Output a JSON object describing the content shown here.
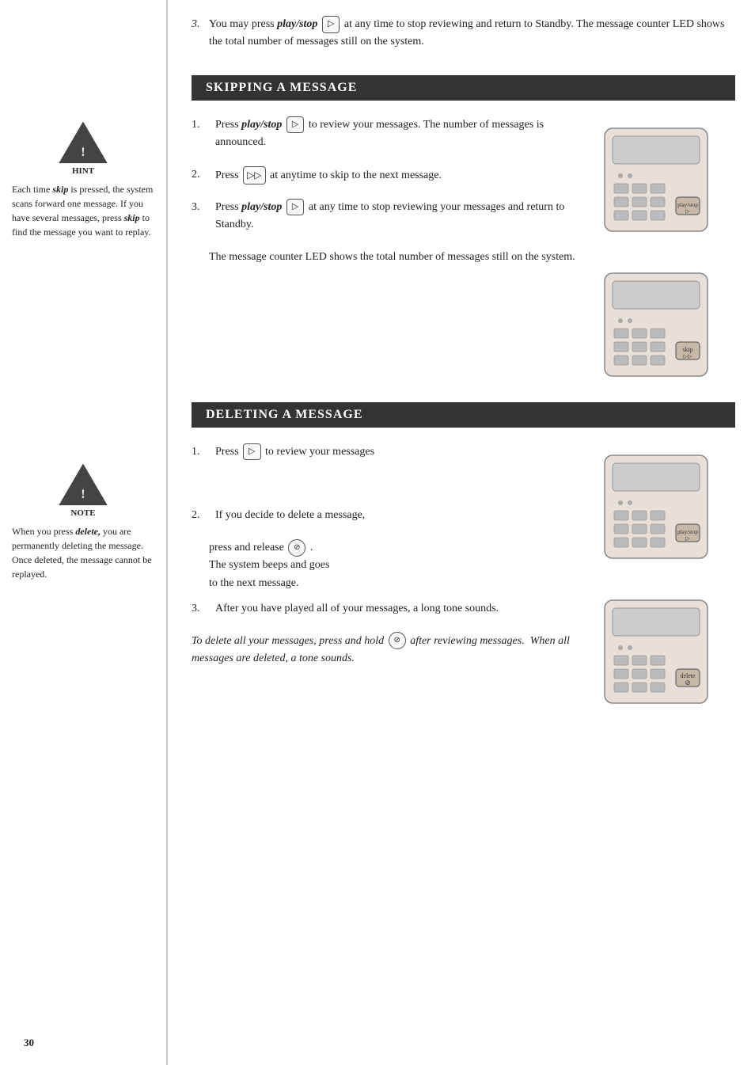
{
  "page": {
    "number": "30"
  },
  "top_section": {
    "item_number": "3.",
    "text_parts": [
      "You may press ",
      "play/stop",
      " ",
      "",
      " at any time to stop reviewing and return to Standby. The message counter LED shows the total number of messages still on the system."
    ]
  },
  "skipping": {
    "header": "SKIPPING A MESSAGE",
    "steps": [
      {
        "num": "1.",
        "text_before": "Press ",
        "bold_italic": "play/stop",
        "text_after": "  to review your messages. The number of messages is announced."
      },
      {
        "num": "2.",
        "text_before": "Press ",
        "text_after": " at anytime to skip to the next message."
      },
      {
        "num": "3.",
        "text_before": "Press ",
        "bold_italic": "play/stop",
        "text_after": "  at any time to stop reviewing your messages and return to Standby."
      }
    ],
    "note_text": "The message counter LED shows the total number of messages still on the system."
  },
  "hint": {
    "label": "HINT",
    "text": "Each time skip is pressed, the system scans forward one message. If you have several messages, press skip to find the message you want to replay."
  },
  "deleting": {
    "header": "DELETING A MESSAGE",
    "steps": [
      {
        "num": "1.",
        "text_before": "Press ",
        "text_after": " to review your messages"
      },
      {
        "num": "2.",
        "text": "If you decide to delete a message,"
      },
      {
        "num": "3.",
        "text": "After you have played all of your messages, a long tone sounds."
      }
    ],
    "sub_step_2a": "press and release ",
    "sub_step_2b": "The system beeps and goes to the next message.",
    "italic_note": "To delete all your messages, press and hold  after reviewing messages.  When all messages are deleted, a tone sounds."
  },
  "note": {
    "label": "NOTE",
    "text": "When you press delete, you are permanently deleting the message. Once deleted, the message cannot be replayed."
  },
  "buttons": {
    "play_stop_symbol": "▷",
    "skip_symbol": "▷▷",
    "delete_symbol": "⊘"
  }
}
